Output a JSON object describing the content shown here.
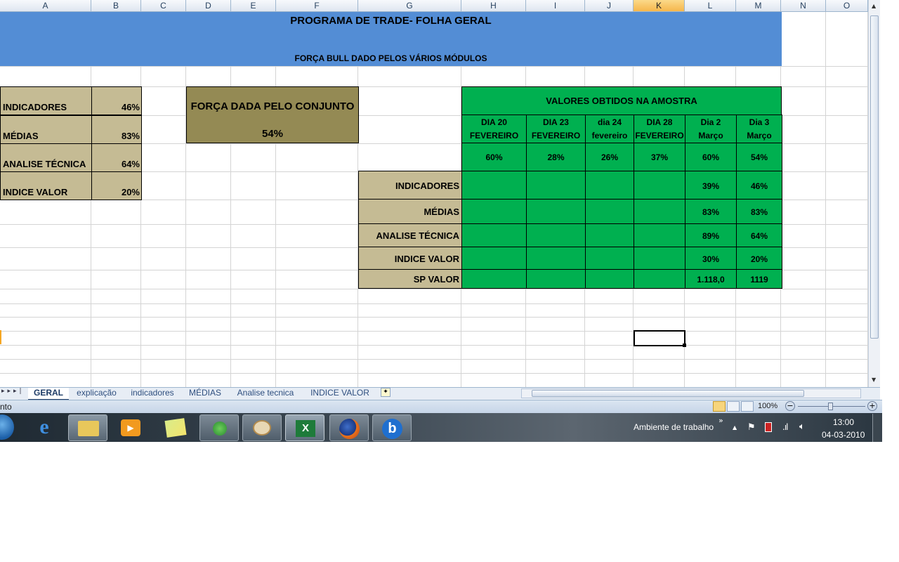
{
  "columns": [
    "A",
    "B",
    "C",
    "D",
    "E",
    "F",
    "G",
    "H",
    "I",
    "J",
    "K",
    "L",
    "M",
    "N",
    "O"
  ],
  "selected_column": "K",
  "title": "PROGRAMA DE TRADE- FOLHA GERAL",
  "subtitle": "FORÇA BULL DADO PELOS VÁRIOS MÓDULOS",
  "left_summary": [
    {
      "label": "INDICADORES",
      "value": "46%"
    },
    {
      "label": "MÉDIAS",
      "value": "83%"
    },
    {
      "label": "ANALISE TÉCNICA",
      "value": "64%"
    },
    {
      "label": "INDICE VALOR",
      "value": "20%"
    }
  ],
  "force_box": {
    "label": "FORÇA DADA PELO CONJUNTO",
    "value": "54%"
  },
  "sample_table": {
    "title": "VALORES OBTIDOS NA AMOSTRA",
    "dates": [
      {
        "line1": "DIA 20",
        "line2": "FEVEREIRO"
      },
      {
        "line1": "DIA 23",
        "line2": "FEVEREIRO"
      },
      {
        "line1": "dia 24",
        "line2": "fevereiro"
      },
      {
        "line1": "DIA 28",
        "line2": "FEVEREIRO"
      },
      {
        "line1": "Dia 2",
        "line2": "Março"
      },
      {
        "line1": "Dia 3",
        "line2": "Março"
      }
    ],
    "totals": [
      "60%",
      "28%",
      "26%",
      "37%",
      "60%",
      "54%"
    ],
    "rows": [
      {
        "label": "INDICADORES",
        "dia2": "39%",
        "dia3": "46%"
      },
      {
        "label": "MÉDIAS",
        "dia2": "83%",
        "dia3": "83%"
      },
      {
        "label": "ANALISE TÉCNICA",
        "dia2": "89%",
        "dia3": "64%"
      },
      {
        "label": "INDICE VALOR",
        "dia2": "30%",
        "dia3": "20%"
      },
      {
        "label": "SP VALOR",
        "dia2": "1.118,0",
        "dia3": "1119"
      }
    ]
  },
  "sheet_tabs": [
    "GERAL",
    "explicação",
    "indicadores",
    "MÉDIAS",
    "Analise tecnica",
    "INDICE VALOR"
  ],
  "active_tab": "GERAL",
  "status_text": "nto",
  "zoom": "100%",
  "taskbar": {
    "apps": [
      "ie-icon",
      "explorer-icon",
      "media-player-icon",
      "sticky-notes-icon",
      "messenger-icon",
      "paint-icon",
      "excel-icon",
      "firefox-icon",
      "bing-icon"
    ],
    "desktop_label": "Ambiente de trabalho",
    "time": "13:00",
    "date": "04-03-2010"
  },
  "colors": {
    "header_blue": "#538dd5",
    "khaki": "#c5bb94",
    "olive": "#948a54",
    "green": "#00b050"
  }
}
